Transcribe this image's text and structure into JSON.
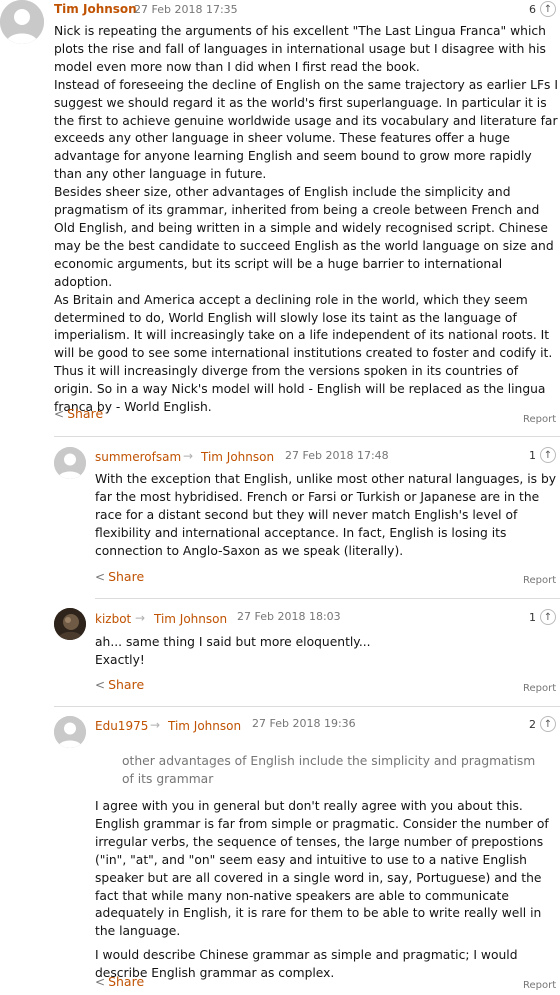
{
  "comments": [
    {
      "user": "Tim Johnson",
      "timestamp": "27 Feb 2018 17:35",
      "recommend_count": "6",
      "paragraphs": [
        "Nick is repeating the arguments of his excellent \"The Last Lingua Franca\" which plots the rise and fall of languages in international usage but I disagree with his model even more now than I did when I first read the book.",
        "Instead of foreseeing the decline of English on the same trajectory as earlier LFs I suggest we should regard it as the world's first superlanguage. In particular it is the first to achieve genuine worldwide usage and its vocabulary and literature far exceeds any other language in sheer volume. These features offer a huge advantage for anyone learning English and seem bound to grow more rapidly than any other language in future.",
        "Besides sheer size, other advantages of English include the simplicity and pragmatism of its grammar, inherited from being a creole between French and Old English, and being written in a simple and widely recognised script. Chinese may be the best candidate to succeed English as the world language on size and economic arguments, but its script will be a huge barrier to international adoption.",
        "As Britain and America accept a declining role in the world, which they seem determined to do, World English will slowly lose its taint as the language of imperialism. It will increasingly take on a life independent of its national roots. It will be good to see some international institutions created to foster and codify it. Thus it will increasingly diverge from the versions spoken in its countries of origin. So in a way Nick's model will hold - English will be replaced as the lingua franca by - World English."
      ],
      "share_label": "Share",
      "report_label": "Report"
    },
    {
      "user": "summerofsam",
      "reply_to": "Tim Johnson",
      "timestamp": "27 Feb 2018 17:48",
      "recommend_count": "1",
      "paragraphs": [
        "With the exception that English, unlike most other natural languages, is by far the most hybridised. French or Farsi or Turkish or Japanese are in the race for a distant second but they will never match English's level of flexibility and international acceptance. In fact, English is losing its connection to Anglo-Saxon as we speak (literally)."
      ],
      "share_label": "Share",
      "report_label": "Report"
    },
    {
      "user": "kizbot",
      "reply_to": "Tim Johnson",
      "timestamp": "27 Feb 2018 18:03",
      "recommend_count": "1",
      "paragraphs": [
        "ah... same thing I said but more eloquently...",
        "Exactly!"
      ],
      "share_label": "Share",
      "report_label": "Report"
    },
    {
      "user": "Edu1975",
      "reply_to": "Tim Johnson",
      "timestamp": "27 Feb 2018 19:36",
      "recommend_count": "2",
      "quote": "other advantages of English include the simplicity and pragmatism of its grammar",
      "paragraphs": [
        "I agree with you in general but don't really agree with you about this. English grammar is far from simple or pragmatic. Consider the number of irregular verbs, the sequence of tenses, the large number of prepostions (\"in\", \"at\", and \"on\" seem easy and intuitive to use to a native English speaker but are all covered in a single word in, say, Portuguese) and the fact that while many non-native speakers are able to communicate adequately in English, it is rare for them to be able to write really well in the language.",
        "I would describe Chinese grammar as simple and pragmatic; I would describe English grammar as complex."
      ],
      "share_label": "Share",
      "report_label": "Report"
    }
  ],
  "icons": {
    "recommend": "up-arrow-icon",
    "share": "share-icon",
    "reply": "reply-arrow-icon",
    "avatar": "user-avatar"
  },
  "colors": {
    "username": "#c05303",
    "meta": "#767676",
    "divider": "#dcdcdc"
  }
}
